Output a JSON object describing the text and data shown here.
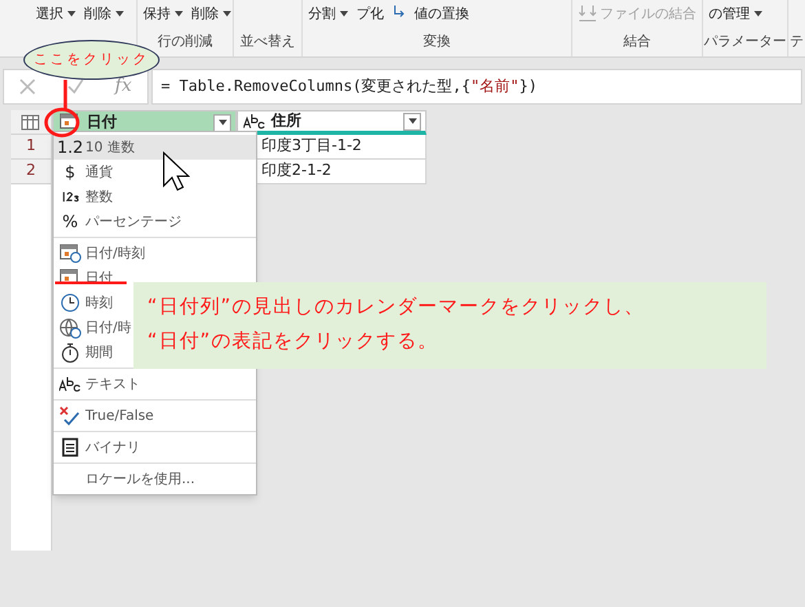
{
  "ribbon": {
    "groups": [
      {
        "buttons": [
          {
            "label": "選択",
            "caret": true
          },
          {
            "label": "削除",
            "caret": true
          }
        ]
      },
      {
        "label": "行の削減",
        "buttons": [
          {
            "label": "保持",
            "caret": true
          },
          {
            "label": "削除",
            "caret": true
          }
        ]
      },
      {
        "label": "並べ替え"
      },
      {
        "label": "変換",
        "buttons": [
          {
            "label": "分割",
            "caret": true
          },
          {
            "label": "プ化",
            "caret": false
          },
          {
            "label": "値の置換",
            "caret": false,
            "kind": "replace"
          }
        ]
      },
      {
        "label": "結合",
        "buttons": [
          {
            "label": "ファイルの結合",
            "caret": false,
            "kind": "combine",
            "disabled": true
          }
        ]
      },
      {
        "label": "パラメーター",
        "buttons": [
          {
            "label": "の管理",
            "caret": true
          }
        ]
      },
      {
        "label": "テ"
      }
    ]
  },
  "callout": {
    "text": "ここをクリック"
  },
  "formula_bar": {
    "fx_label": "fx",
    "prefix": "= Table.RemoveColumns(変更された型,{",
    "string": "\"名前\"",
    "suffix": "})"
  },
  "table": {
    "columns": [
      {
        "name": "日付",
        "kind": "date",
        "selected": true
      },
      {
        "name": "住所",
        "kind": "text",
        "selected": false
      }
    ],
    "rows": [
      {
        "number": "1",
        "cells": [
          "",
          "印度3丁目-1-2"
        ]
      },
      {
        "number": "2",
        "cells": [
          "",
          "印度2-1-2"
        ]
      }
    ]
  },
  "type_menu": {
    "items": [
      {
        "kind": "text-icon",
        "icon_text": "1.2",
        "label": "10 進数",
        "selected": true
      },
      {
        "kind": "text-icon",
        "icon_text": "$",
        "label": "通貨",
        "selected": false
      },
      {
        "kind": "whole",
        "label": "整数",
        "selected": false
      },
      {
        "kind": "text-icon",
        "icon_text": "%",
        "label": "パーセンテージ",
        "selected": false,
        "divider": true
      },
      {
        "kind": "datetime",
        "label": "日付/時刻",
        "selected": false
      },
      {
        "kind": "date",
        "label": "日付",
        "selected": false
      },
      {
        "kind": "time",
        "label": "時刻",
        "selected": false
      },
      {
        "kind": "datetimezone",
        "label": "日付/時",
        "selected": false
      },
      {
        "kind": "duration",
        "label": "期間",
        "selected": false,
        "divider": true
      },
      {
        "kind": "abc",
        "label": "テキスト",
        "selected": false,
        "divider": true
      },
      {
        "kind": "bool",
        "label": "True/False",
        "selected": false,
        "divider": true
      },
      {
        "kind": "binary",
        "label": "バイナリ",
        "selected": false,
        "divider": true
      },
      {
        "kind": "none",
        "label": "ロケールを使用...",
        "selected": false
      }
    ]
  },
  "annotation": {
    "lines": [
      "“日付列”の見出しのカレンダーマークをクリックし、",
      "“日付”の表記をクリックする。"
    ]
  }
}
